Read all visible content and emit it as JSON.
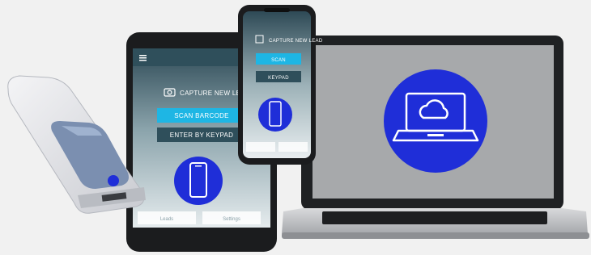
{
  "tablet": {
    "capture_title": "CAPTURE NEW LEAD",
    "scan_label": "SCAN BARCODE",
    "keypad_label": "ENTER BY KEYPAD",
    "footer_left": "Leads",
    "footer_right": "Settings"
  },
  "phone": {
    "capture_title": "CAPTURE NEW LEAD",
    "scan_label": "SCAN",
    "keypad_label": "KEYPAD"
  },
  "colors": {
    "brand_blue": "#1f2ed8",
    "app_teal": "#1eb6e4",
    "header_slate": "#2f4f5b"
  },
  "icons": [
    "barcode-scanner",
    "camera-icon",
    "phone-icon",
    "laptop-cloud-icon",
    "menu-icon"
  ]
}
